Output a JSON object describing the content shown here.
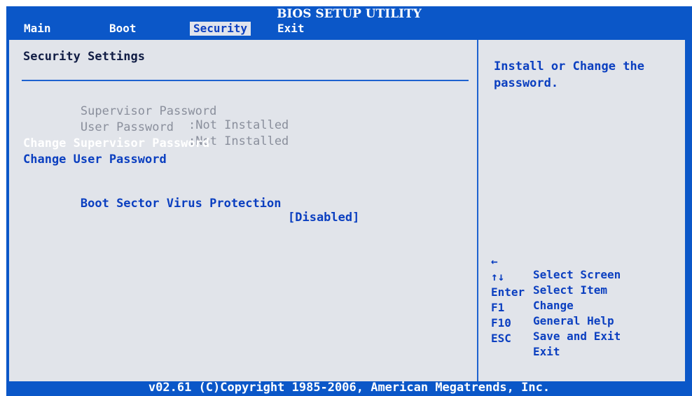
{
  "title": "BIOS SETUP UTILITY",
  "menu": [
    {
      "label": "Main"
    },
    {
      "label": "Boot"
    },
    {
      "label": "Security",
      "active": true
    },
    {
      "label": "Exit"
    }
  ],
  "section_title": "Security Settings",
  "status_rows": [
    {
      "label": "Supervisor Password",
      "value": ":Not Installed"
    },
    {
      "label": "User Password",
      "value": ":Not Installed"
    }
  ],
  "actions": {
    "change_supervisor": "Change Supervisor Password",
    "change_user": "Change User Password"
  },
  "options": {
    "boot_sector_label": "Boot Sector Virus Protection",
    "boot_sector_value": "[Disabled]"
  },
  "help": "Install or Change the password.",
  "keys": [
    {
      "key": "←",
      "icon": "left-arrow-icon",
      "desc": "Select Screen"
    },
    {
      "key": "↑↓",
      "icon": "up-down-arrows-icon",
      "desc": "Select Item"
    },
    {
      "key": "Enter",
      "desc": "Change"
    },
    {
      "key": "F1",
      "desc": "General Help"
    },
    {
      "key": "F10",
      "desc": "Save and Exit"
    },
    {
      "key": "ESC",
      "desc": "Exit"
    }
  ],
  "footer": "v02.61 (C)Copyright 1985-2006, American Megatrends, Inc.",
  "colors": {
    "background_blue": "#0b57c8",
    "panel_gray": "#e1e4ea",
    "text_blue": "#0b3fc0",
    "dim_gray": "#8a8f9c"
  }
}
